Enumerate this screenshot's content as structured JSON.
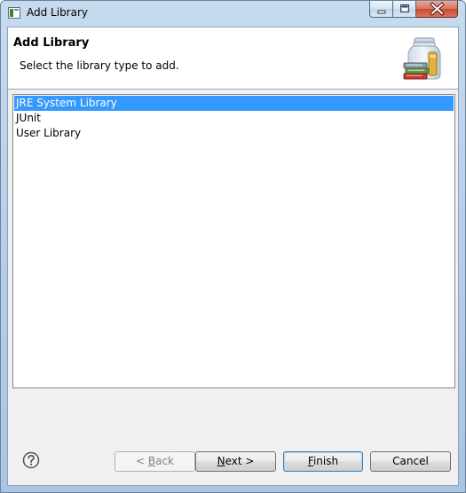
{
  "window": {
    "title": "Add Library",
    "controls": {
      "minimize_icon": "minimize-icon",
      "maximize_icon": "maximize-icon",
      "close_icon": "close-icon"
    }
  },
  "header": {
    "title": "Add Library",
    "description": "Select the library type to add.",
    "icon": "library-jar-icon"
  },
  "library_types": {
    "items": [
      {
        "label": "JRE System Library",
        "selected": true
      },
      {
        "label": "JUnit",
        "selected": false
      },
      {
        "label": "User Library",
        "selected": false
      }
    ]
  },
  "buttons": {
    "help_icon": "help-icon",
    "back": {
      "prefix": "< ",
      "mnemonic": "B",
      "rest": "ack",
      "enabled": false
    },
    "next": {
      "mnemonic": "N",
      "rest": "ext >",
      "enabled": true
    },
    "finish": {
      "mnemonic": "F",
      "rest": "inish",
      "enabled": true,
      "default": true
    },
    "cancel": {
      "label": "Cancel",
      "enabled": true
    }
  },
  "colors": {
    "selection": "#3399ff",
    "selection_text": "#ffffff",
    "dialog_background": "#f0f0f0",
    "titlebar": "#b9d1ea",
    "close_button": "#c74a2f"
  }
}
